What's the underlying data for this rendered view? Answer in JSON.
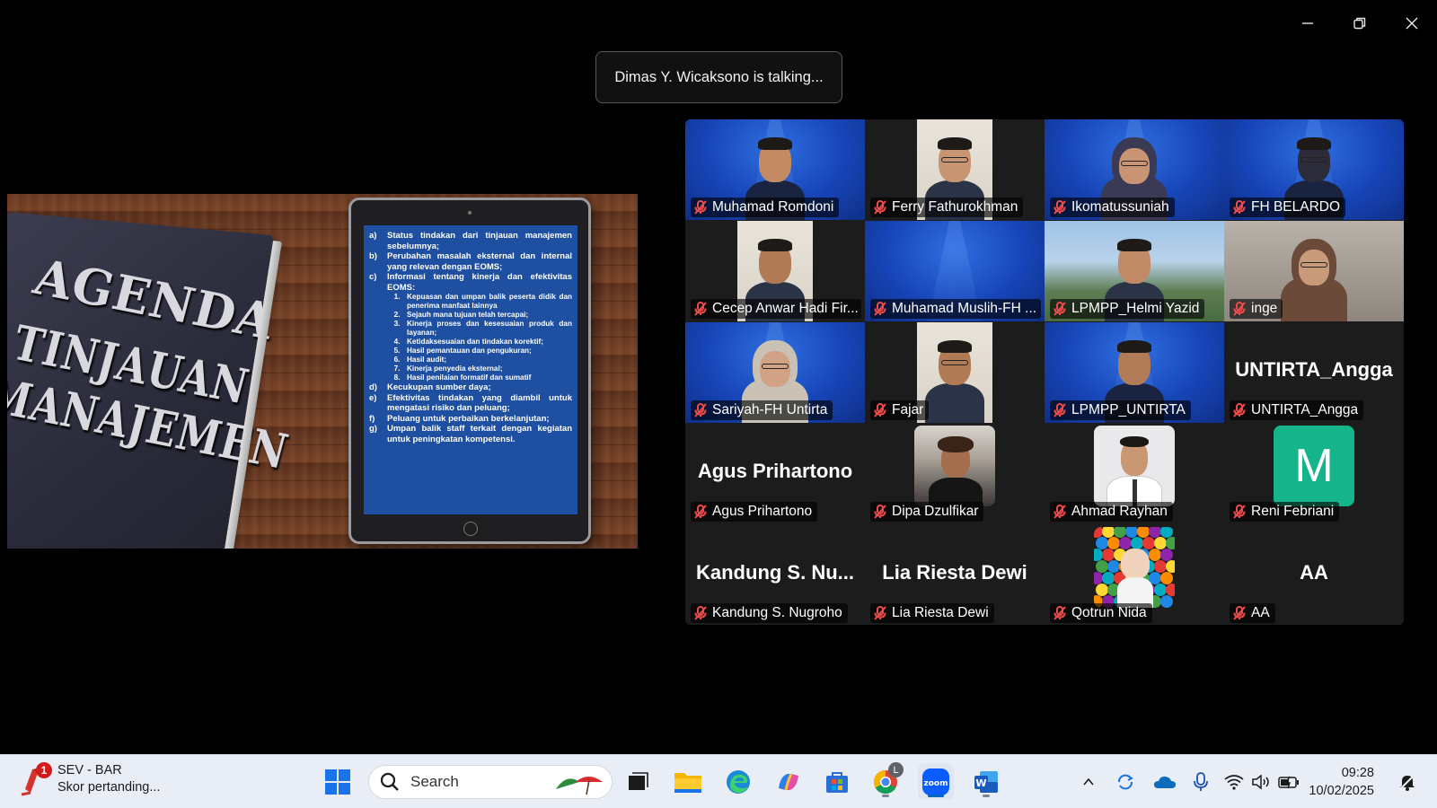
{
  "window": {
    "controls": [
      "minimize-icon",
      "restore-icon",
      "close-icon"
    ]
  },
  "talking_banner": "Dimas Y. Wicaksono is talking...",
  "shared_screen": {
    "book_title": [
      "AGENDA",
      "TINJAUAN",
      "MANAJEMEN"
    ],
    "agenda": [
      {
        "k": "a)",
        "t": "Status tindakan dari tinjauan manajemen sebelumnya;"
      },
      {
        "k": "b)",
        "t": "Perubahan masalah eksternal dan internal yang relevan dengan EOMS;"
      },
      {
        "k": "c)",
        "t": "Informasi tentang kinerja dan efektivitas EOMS:"
      },
      {
        "k": "1.",
        "t": "Kepuasan dan umpan balik peserta didik dan penerima manfaat lainnya",
        "sub": true
      },
      {
        "k": "2.",
        "t": "Sejauh mana tujuan telah tercapai;",
        "sub": true
      },
      {
        "k": "3.",
        "t": "Kinerja proses dan kesesuaian produk dan layanan;",
        "sub": true
      },
      {
        "k": "4.",
        "t": "Ketidaksesuaian dan tindakan korektif;",
        "sub": true
      },
      {
        "k": "5.",
        "t": "Hasil pemantauan dan pengukuran;",
        "sub": true
      },
      {
        "k": "6.",
        "t": "Hasil audit;",
        "sub": true
      },
      {
        "k": "7.",
        "t": "Kinerja penyedia eksternal;",
        "sub": true
      },
      {
        "k": "8.",
        "t": "Hasil penilaian formatif dan sumatif",
        "sub": true
      },
      {
        "k": "d)",
        "t": "Kecukupan sumber daya;"
      },
      {
        "k": "e)",
        "t": "Efektivitas tindakan yang diambil untuk mengatasi risiko dan peluang;"
      },
      {
        "k": "f)",
        "t": "Peluang untuk perbaikan berkelanjutan;"
      },
      {
        "k": "g)",
        "t": "Umpan balik staff terkait dengan kegiatan untuk peningkatan kompetensi."
      }
    ]
  },
  "participants": [
    {
      "name": "Muhamad Romdoni",
      "kind": "video",
      "bg": "blue",
      "skin": "#c48a63"
    },
    {
      "name": "Ferry Fathurokhman",
      "kind": "video-narrow",
      "bg": "office",
      "skin": "#c89572"
    },
    {
      "name": "Ikomatussuniah",
      "kind": "video",
      "bg": "blue",
      "skin": "#c99473",
      "hijab": "#3a3a55"
    },
    {
      "name": "FH BELARDO",
      "kind": "video",
      "bg": "blue",
      "skin": "#2b2b3a"
    },
    {
      "name": "Cecep Anwar Hadi Fir...",
      "kind": "video-narrow",
      "bg": "office",
      "skin": "#b07a55"
    },
    {
      "name": "Muhamad Muslih-FH ...",
      "kind": "video",
      "bg": "blue",
      "skin": ""
    },
    {
      "name": "LPMPP_Helmi Yazid",
      "kind": "video",
      "bg": "campus",
      "skin": "#c08a66"
    },
    {
      "name": "inge",
      "kind": "video",
      "bg": "grey",
      "skin": "#c99a7a",
      "hijab": "#6b4a3a"
    },
    {
      "name": "Sariyah-FH Untirta",
      "kind": "video",
      "bg": "blue",
      "skin": "#d2a286",
      "hijab": "#c9c2b4"
    },
    {
      "name": "Fajar",
      "kind": "video-narrow",
      "bg": "office",
      "skin": "#b07a55"
    },
    {
      "name": "LPMPP_UNTIRTA",
      "kind": "video",
      "bg": "blue",
      "skin": "#b27b58"
    },
    {
      "name": "UNTIRTA_Angga",
      "kind": "name",
      "display": "UNTIRTA_Angga"
    },
    {
      "name": "Agus Prihartono",
      "kind": "name",
      "display": "Agus Prihartono"
    },
    {
      "name": "Dipa Dzulfikar",
      "kind": "photo",
      "photo": "crowd"
    },
    {
      "name": "Ahmad Rayhan",
      "kind": "photo",
      "photo": "formal"
    },
    {
      "name": "Reni Febriani",
      "kind": "avatar",
      "letter": "M"
    },
    {
      "name": "Kandung S. Nugroho",
      "kind": "name",
      "display": "Kandung S. Nu..."
    },
    {
      "name": "Lia Riesta Dewi",
      "kind": "name",
      "display": "Lia Riesta Dewi"
    },
    {
      "name": "Qotrun Nida",
      "kind": "photo",
      "photo": "balls"
    },
    {
      "name": "AA",
      "kind": "name",
      "display": "AA"
    }
  ],
  "taskbar": {
    "widget": {
      "title": "SEV - BAR",
      "subtitle": "Skor pertanding...",
      "badge": "1"
    },
    "search_placeholder": "Search",
    "chrome_badge": "L",
    "time": "09:28",
    "date": "10/02/2025"
  },
  "colors": {
    "accent": "#0067c0",
    "zoom_blue": "#0b5cff",
    "muted_red": "#f04b4b",
    "slide_blue": "#1e4fa0",
    "avatar_green": "#15b48a"
  }
}
